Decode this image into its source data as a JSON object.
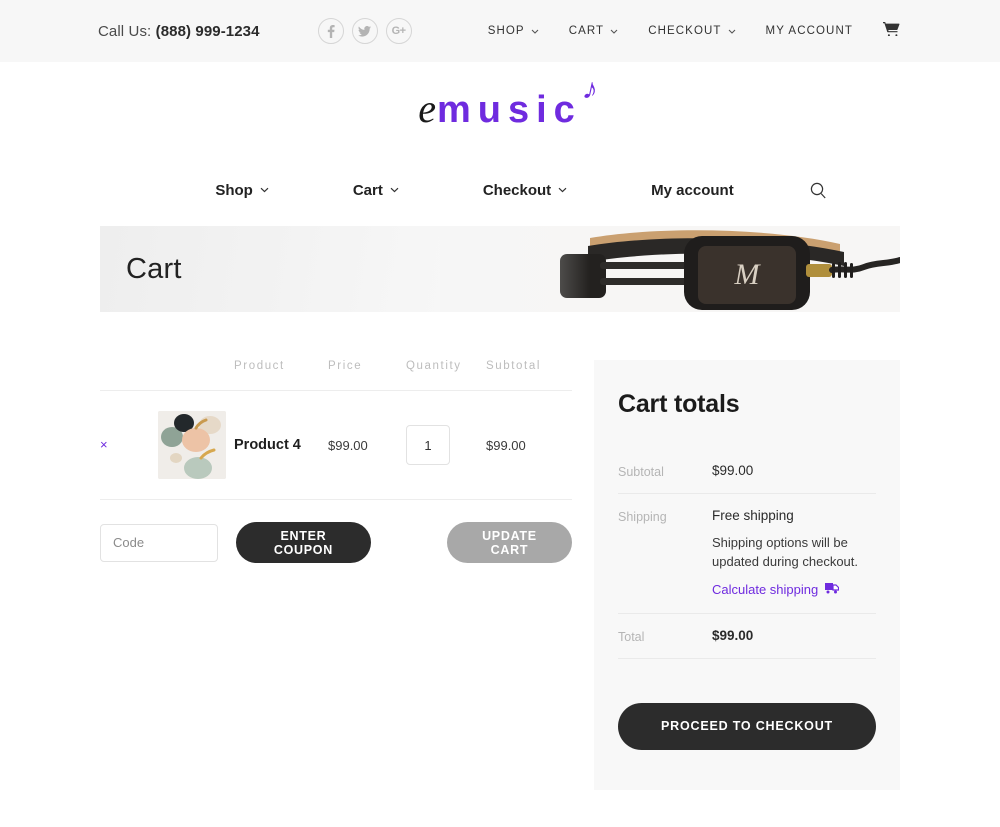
{
  "topbar": {
    "call_label": "Call Us:",
    "phone": "(888) 999-1234",
    "social": [
      {
        "name": "facebook-icon",
        "label": "f"
      },
      {
        "name": "twitter-icon",
        "label": "t"
      },
      {
        "name": "google-plus-icon",
        "label": "G+"
      }
    ],
    "nav": [
      {
        "label": "SHOP",
        "caret": true
      },
      {
        "label": "CART",
        "caret": true
      },
      {
        "label": "CHECKOUT",
        "caret": true
      },
      {
        "label": "MY ACCOUNT",
        "caret": false
      }
    ],
    "cart_icon": "shopping-cart-icon"
  },
  "logo": {
    "first": "e",
    "rest": "music",
    "note": "♪",
    "color": "#6f2bdf"
  },
  "mainnav": {
    "items": [
      {
        "label": "Shop",
        "caret": true
      },
      {
        "label": "Cart",
        "caret": true
      },
      {
        "label": "Checkout",
        "caret": true
      },
      {
        "label": "My account",
        "caret": false
      }
    ],
    "search_icon": "search-icon"
  },
  "banner": {
    "title": "Cart"
  },
  "cart": {
    "headers": [
      "Product",
      "Price",
      "Quantity",
      "Subtotal"
    ],
    "rows": [
      {
        "remove": "×",
        "name": "Product 4",
        "price": "$99.00",
        "quantity": "1",
        "subtotal": "$99.00"
      }
    ],
    "coupon_placeholder": "Code",
    "coupon_value": "",
    "enter_coupon_label": "ENTER COUPON",
    "update_cart_label": "UPDATE CART"
  },
  "totals": {
    "title": "Cart totals",
    "subtotal_label": "Subtotal",
    "subtotal_value": "$99.00",
    "shipping_label": "Shipping",
    "shipping_value": "Free shipping",
    "shipping_note": "Shipping options will be updated during checkout.",
    "calculate_label": "Calculate shipping",
    "total_label": "Total",
    "total_value": "$99.00",
    "checkout_label": "PROCEED TO CHECKOUT",
    "link_color": "#6f2bdf"
  }
}
